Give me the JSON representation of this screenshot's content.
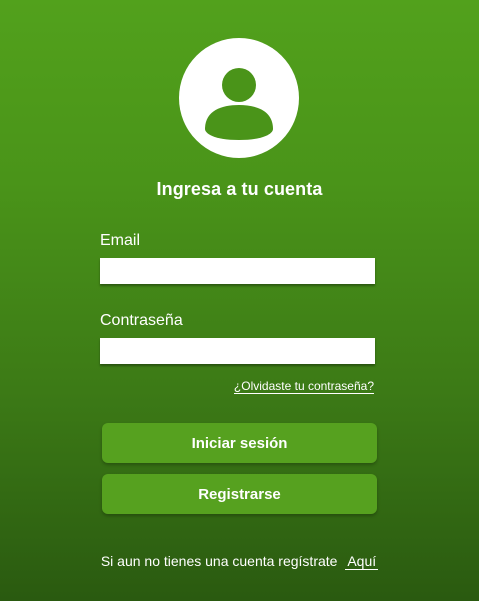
{
  "login": {
    "title": "Ingresa a tu cuenta",
    "email_label": "Email",
    "email_value": "",
    "password_label": "Contraseña",
    "password_value": "",
    "forgot_link": "¿Olvidaste tu contraseña?",
    "login_button": "Iniciar sesión",
    "register_button": "Registrarse",
    "footer_text": "Si aun no tienes una cuenta regístrate",
    "footer_link": "Aquí"
  },
  "icons": {
    "avatar": "user-avatar-icon"
  },
  "colors": {
    "background_top": "#52a11c",
    "background_bottom": "#2a5a10",
    "button": "#56a11f",
    "text": "#ffffff"
  }
}
